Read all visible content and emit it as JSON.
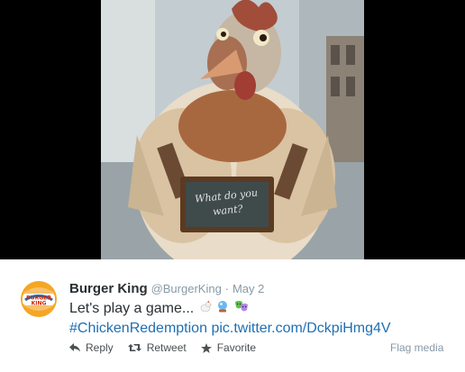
{
  "tweet": {
    "author_name": "Burger King",
    "handle": "@BurgerKing",
    "separator": "·",
    "date": "May 2",
    "text": "Let's play a game...",
    "emoji_icons": [
      "chicken-emoji-icon",
      "crystal-ball-emoji-icon",
      "performing-arts-emoji-icon"
    ],
    "hashtag": "#ChickenRedemption",
    "pic_link": "pic.twitter.com/DckpiHmg4V",
    "brand_logo_text": "BURGER KING"
  },
  "photo": {
    "sign_text": "What do you want?"
  },
  "actions": {
    "reply": "Reply",
    "retweet": "Retweet",
    "favorite": "Favorite",
    "flag": "Flag media"
  },
  "colors": {
    "link": "#1f6fb2",
    "name": "#292f33",
    "meta": "#8899a6",
    "media_bg": "#000000"
  }
}
